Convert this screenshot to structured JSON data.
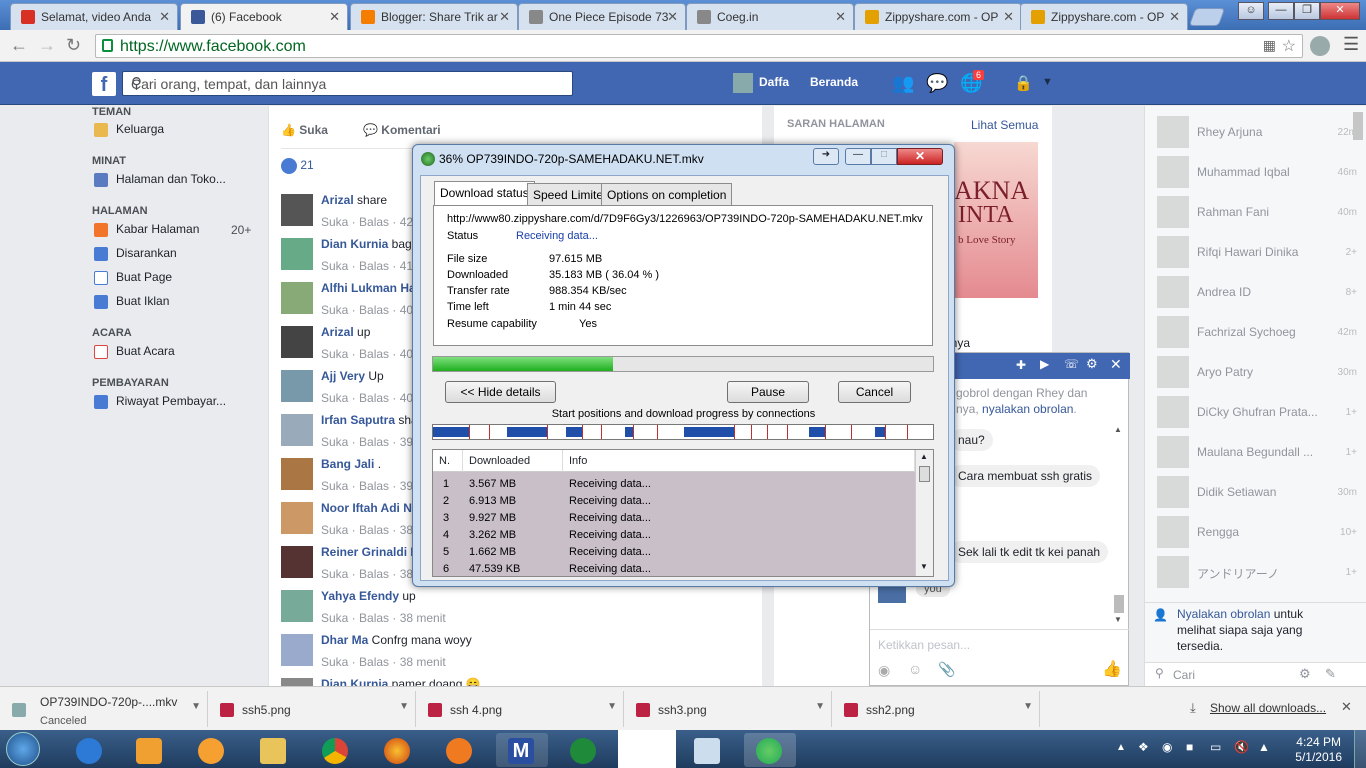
{
  "browser": {
    "tabs": [
      {
        "title": "Selamat, video Anda",
        "color": "#d93025"
      },
      {
        "title": "(6) Facebook",
        "color": "#3b5998"
      },
      {
        "title": "Blogger: Share Trik ar",
        "color": "#f57d00"
      },
      {
        "title": "One Piece Episode 73",
        "color": "#888888"
      },
      {
        "title": "Coeg.in",
        "color": "#888888"
      },
      {
        "title": "Zippyshare.com - OP",
        "color": "#e3a000"
      },
      {
        "title": "Zippyshare.com - OP",
        "color": "#e3a000"
      }
    ],
    "url": "https://www.facebook.com"
  },
  "facebook": {
    "logo": "f",
    "search_placeholder": "Cari orang, tempat, dan lainnya",
    "header_user": "Daffa",
    "header_home": "Beranda",
    "notif_count": "6",
    "left_nav": {
      "sec_teman": "TEMAN",
      "keluarga": "Keluarga",
      "sec_minat": "MINAT",
      "halaman_toko": "Halaman dan Toko...",
      "sec_halaman": "HALAMAN",
      "kabar_halaman": "Kabar Halaman",
      "kabar_count": "20+",
      "disarankan": "Disarankan",
      "buat_page": "Buat Page",
      "buat_iklan": "Buat Iklan",
      "sec_acara": "ACARA",
      "buat_acara": "Buat Acara",
      "sec_pembayaran": "PEMBAYARAN",
      "riwayat": "Riwayat Pembayar..."
    },
    "post_actions": {
      "like": "Suka",
      "comment": "Komentari",
      "likes_count": "21"
    },
    "comments": [
      {
        "name": "Arizal",
        "text": " share",
        "meta": "Suka · Balas · 42"
      },
      {
        "name": "Dian Kurnia",
        "text": " bag",
        "meta": "Suka · Balas · 41"
      },
      {
        "name": "Alfhi Lukman Ha",
        "text": "",
        "meta": "Suka · Balas · 40"
      },
      {
        "name": "Arizal",
        "text": " up",
        "meta": "Suka · Balas · 40"
      },
      {
        "name": "Ajj Very",
        "text": " Up",
        "meta": "Suka · Balas · 40"
      },
      {
        "name": "Irfan Saputra",
        "text": " sha",
        "meta": "Suka · Balas · 39"
      },
      {
        "name": "Bang Jali",
        "text": " .",
        "meta": "Suka · Balas · 39"
      },
      {
        "name": "Noor Iftah Adi N",
        "text": "",
        "meta": "Suka · Balas · 38"
      },
      {
        "name": "Reiner Grinaldi D",
        "text": "",
        "meta": "Suka · Balas · 38"
      },
      {
        "name": "Yahya Efendy",
        "text": " up",
        "meta": "Suka · Balas · 38 menit"
      },
      {
        "name": "Dhar Ma",
        "text": " Confrg mana woyy",
        "meta": "Suka · Balas · 38 menit"
      },
      {
        "name": "Dian Kurnia",
        "text": " pamer doang 😄",
        "meta": ""
      }
    ],
    "suggest": {
      "title": "SARAN HALAMAN",
      "see_all": "Lihat Semua",
      "img_text_1": "AKNA",
      "img_text_2": "INTA",
      "img_text_3": "b Love Story",
      "frag": "anya"
    },
    "chat_popup": {
      "intro_1": "gobrol dengan Rhey dan",
      "intro_2": "nya, ",
      "intro_link": "nyalakan obrolan",
      "msg1": "nau?",
      "msg2": "Cara membuat ssh gratis",
      "msg3": "Sek lali tk edit tk kei panah",
      "msg4": "you",
      "input_placeholder": "Ketikkan pesan..."
    },
    "chat_sidebar": {
      "friends": [
        {
          "name": "Rhey Arjuna",
          "time": "22m"
        },
        {
          "name": "Muhammad Iqbal",
          "time": "46m"
        },
        {
          "name": "Rahman Fani",
          "time": "40m"
        },
        {
          "name": "Rifqi Hawari Dinika",
          "time": "2+"
        },
        {
          "name": "Andrea ID",
          "time": "8+"
        },
        {
          "name": "Fachrizal Sychoeg",
          "time": "42m"
        },
        {
          "name": "Aryo Patry",
          "time": "30m"
        },
        {
          "name": "DiCky Ghufran Prata...",
          "time": "1+"
        },
        {
          "name": "Maulana Begundall ...",
          "time": "1+"
        },
        {
          "name": "Didik Setiawan",
          "time": "30m"
        },
        {
          "name": "Rengga",
          "time": "10+"
        },
        {
          "name": "アンドリアーノ",
          "time": "1+"
        }
      ],
      "enable_link": "Nyalakan obrolan",
      "enable_rest_1": " untuk",
      "enable_rest_2": "melihat siapa saja yang",
      "enable_rest_3": "tersedia.",
      "search_placeholder": "Cari"
    }
  },
  "idm": {
    "title": "36% OP739INDO-720p-SAMEHADAKU.NET.mkv",
    "tabs": [
      "Download status",
      "Speed Limiter",
      "Options on completion"
    ],
    "url": "http://www80.zippyshare.com/d/7D9F6Gy3/1226963/OP739INDO-720p-SAMEHADAKU.NET.mkv",
    "status_label": "Status",
    "status_value": "Receiving data...",
    "file_size_label": "File size",
    "file_size": "97.615  MB",
    "downloaded_label": "Downloaded",
    "downloaded": "35.183  MB  ( 36.04 % )",
    "rate_label": "Transfer rate",
    "rate": "988.354  KB/sec",
    "time_left_label": "Time left",
    "time_left": "1 min 44 sec",
    "resume_label": "Resume capability",
    "resume": "Yes",
    "progress_percent": 36.04,
    "hide_details": "<< Hide details",
    "pause": "Pause",
    "cancel": "Cancel",
    "connections_caption": "Start positions and download progress by connections",
    "columns": [
      "N.",
      "Downloaded",
      "Info"
    ],
    "connections": [
      {
        "n": "1",
        "downloaded": "3.567  MB",
        "info": "Receiving data..."
      },
      {
        "n": "2",
        "downloaded": "6.913  MB",
        "info": "Receiving data..."
      },
      {
        "n": "3",
        "downloaded": "9.927  MB",
        "info": "Receiving data..."
      },
      {
        "n": "4",
        "downloaded": "3.262  MB",
        "info": "Receiving data..."
      },
      {
        "n": "5",
        "downloaded": "1.662  MB",
        "info": "Receiving data..."
      },
      {
        "n": "6",
        "downloaded": "47.539  KB",
        "info": "Receiving data..."
      }
    ]
  },
  "downloads": {
    "items": [
      {
        "name": "OP739INDO-720p-....mkv",
        "sub": "Canceled"
      },
      {
        "name": "ssh5.png",
        "sub": ""
      },
      {
        "name": "ssh 4.png",
        "sub": ""
      },
      {
        "name": "ssh3.png",
        "sub": ""
      },
      {
        "name": "ssh2.png",
        "sub": ""
      }
    ],
    "show_all": "Show all downloads..."
  },
  "taskbar": {
    "time": "4:24 PM",
    "date": "5/1/2016",
    "app_m_label": "M"
  }
}
